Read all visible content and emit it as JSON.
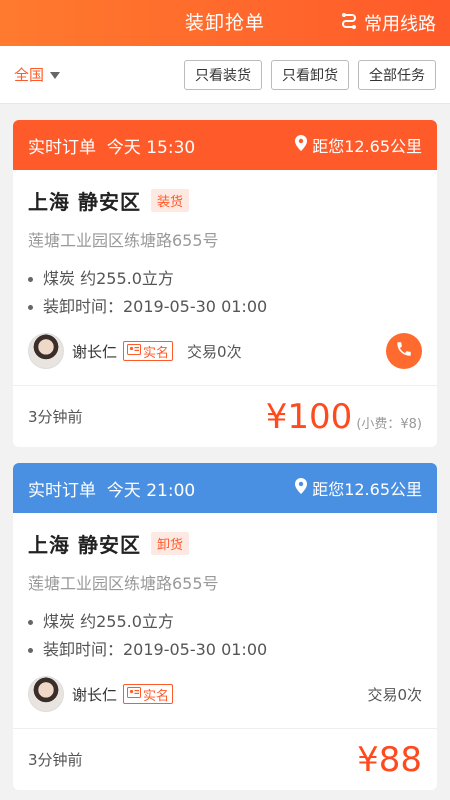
{
  "header": {
    "title": "装卸抢单",
    "routes_label": "常用线路"
  },
  "filter": {
    "region": "全国",
    "buttons": [
      "只看装货",
      "只看卸货",
      "全部任务"
    ]
  },
  "colors": {
    "accent": "#ff5a2a",
    "blue_head": "#4a90e2"
  },
  "orders": [
    {
      "head": "实时订单  今天 15:30",
      "distance": "距您12.65公里",
      "city": "上海 静安区",
      "tag": "装货",
      "address": "莲塘工业园区练塘路655号",
      "cargo": "煤炭 约255.0立方",
      "time": "装卸时间：2019-05-30 01:00",
      "user": "谢长仁",
      "verified": "实名",
      "deals": "交易0次",
      "ago": "3分钟前",
      "price": "¥100",
      "tip": "(小费：¥8)"
    },
    {
      "head": "实时订单  今天 21:00",
      "distance": "距您12.65公里",
      "city": "上海 静安区",
      "tag": "卸货",
      "address": "莲塘工业园区练塘路655号",
      "cargo": "煤炭 约255.0立方",
      "time": "装卸时间：2019-05-30 01:00",
      "user": "谢长仁",
      "verified": "实名",
      "deals": "交易0次",
      "ago": "3分钟前",
      "price": "¥88"
    }
  ]
}
